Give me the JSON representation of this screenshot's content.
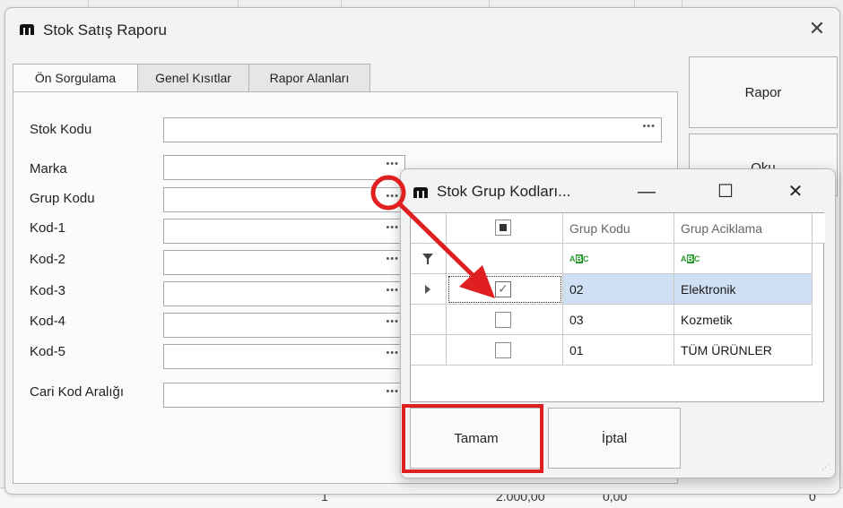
{
  "background": {
    "row_values": [
      "1",
      "2.000,00",
      "0,00",
      "0"
    ]
  },
  "main_window": {
    "title": "Stok Satış Raporu",
    "close_glyph": "✕",
    "tabs": [
      {
        "label": "Ön Sorgulama",
        "active": true
      },
      {
        "label": "Genel Kısıtlar",
        "active": false
      },
      {
        "label": "Rapor Alanları",
        "active": false
      }
    ],
    "fields": [
      {
        "label": "Stok Kodu",
        "value": ""
      },
      {
        "label": "Marka",
        "value": ""
      },
      {
        "label": "Grup Kodu",
        "value": ""
      },
      {
        "label": "Kod-1",
        "value": ""
      },
      {
        "label": "Kod-2",
        "value": ""
      },
      {
        "label": "Kod-3",
        "value": ""
      },
      {
        "label": "Kod-4",
        "value": ""
      },
      {
        "label": "Kod-5",
        "value": ""
      },
      {
        "label": "Cari Kod Aralığı",
        "value": ""
      }
    ],
    "ellipsis": "•••",
    "buttons": {
      "rapor": "Rapor",
      "oku": "Oku"
    }
  },
  "popup": {
    "title": "Stok Grup Kodları...",
    "minimize_glyph": "—",
    "maximize_glyph": "☐",
    "close_glyph": "✕",
    "columns": [
      "Grup Kodu",
      "Grup Aciklama"
    ],
    "filter_marker": "ABC",
    "rows": [
      {
        "kod": "02",
        "aciklama": "Elektronik",
        "checked": true,
        "selected": true
      },
      {
        "kod": "03",
        "aciklama": "Kozmetik",
        "checked": false,
        "selected": false
      },
      {
        "kod": "01",
        "aciklama": "TÜM ÜRÜNLER",
        "checked": false,
        "selected": false
      }
    ],
    "check_glyph": "✓",
    "buttons": {
      "tamam": "Tamam",
      "iptal": "İptal"
    }
  },
  "colors": {
    "annotation": "#e02020",
    "selection": "#cfe0f4"
  }
}
